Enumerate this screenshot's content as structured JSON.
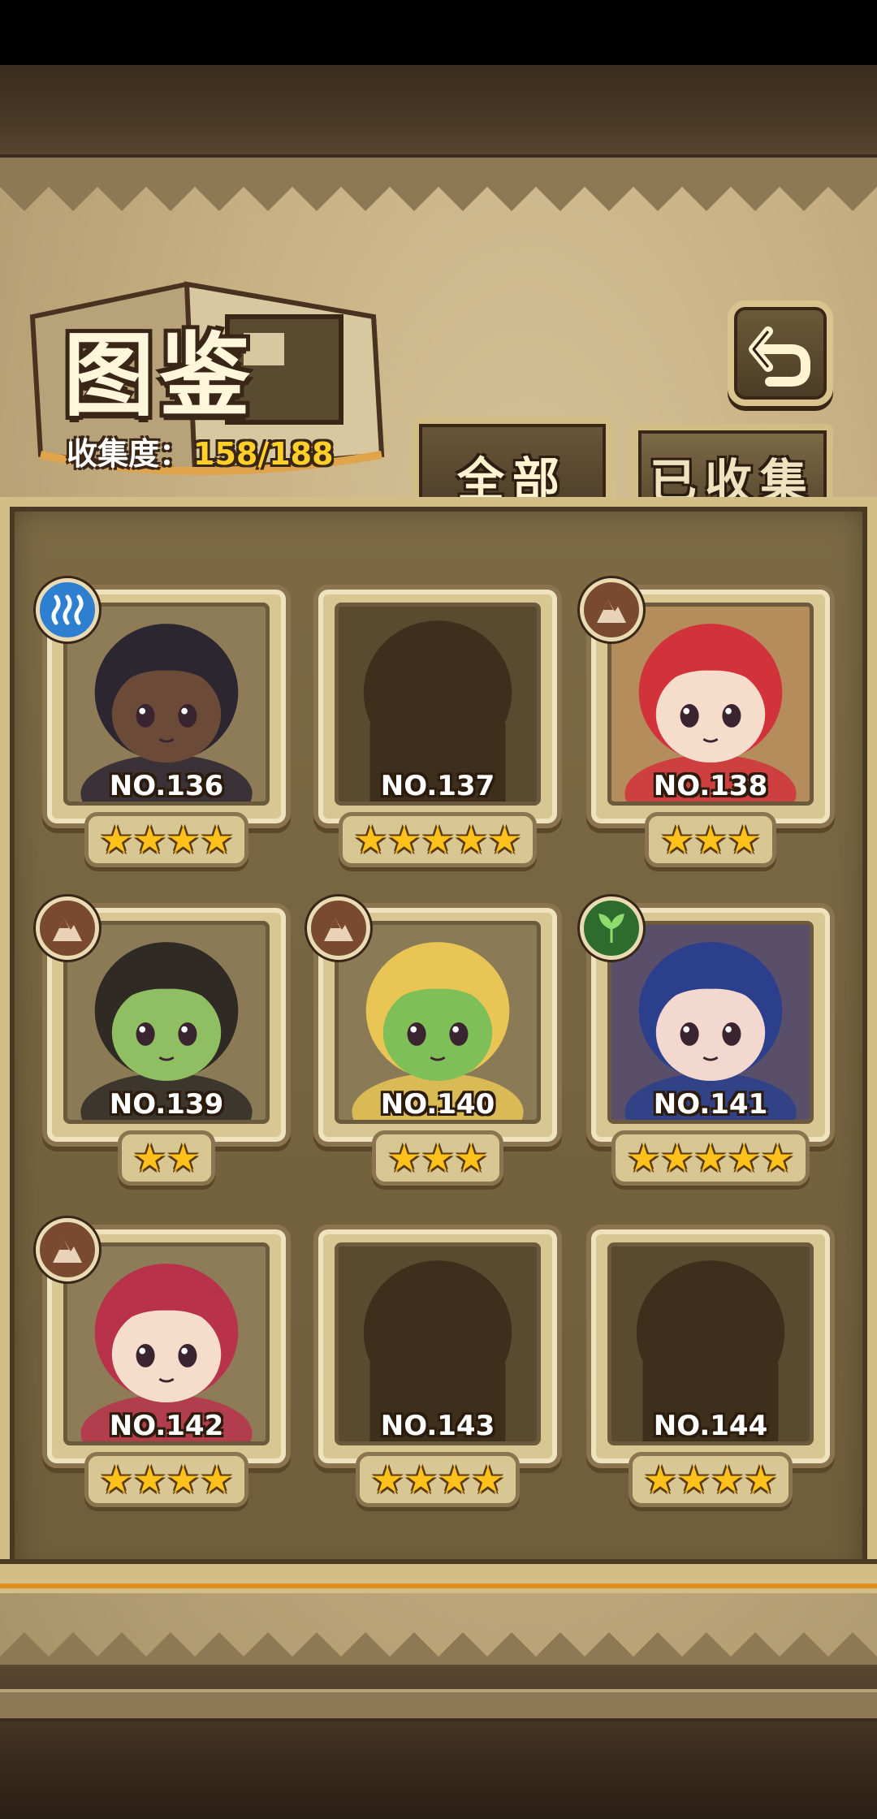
{
  "header": {
    "title": "图鉴",
    "collect_label": "收集度：",
    "collect_value": "158/188"
  },
  "tabs": [
    {
      "label": "全部",
      "active": true
    },
    {
      "label": "已收集",
      "active": false
    }
  ],
  "cards": [
    {
      "number": "NO.136",
      "stars": "★★★★",
      "element": "water-icon",
      "owned": true,
      "hair": "#2b2630",
      "skin": "#6b4a38",
      "bg": "#8e7c58"
    },
    {
      "number": "NO.137",
      "stars": "★★★★★",
      "element": "",
      "owned": false
    },
    {
      "number": "NO.138",
      "stars": "★★★",
      "element": "earth-icon",
      "owned": true,
      "hair": "#d2333a",
      "skin": "#f6dccb",
      "bg": "#b58c5c"
    },
    {
      "number": "NO.139",
      "stars": "★★",
      "element": "earth-icon",
      "owned": true,
      "hair": "#2f2a24",
      "skin": "#8fbf62",
      "bg": "#8a7a56"
    },
    {
      "number": "NO.140",
      "stars": "★★★",
      "element": "earth-icon",
      "owned": true,
      "hair": "#e8c554",
      "skin": "#7fbf57",
      "bg": "#8a7a56"
    },
    {
      "number": "NO.141",
      "stars": "★★★★★",
      "element": "grass-icon",
      "owned": true,
      "hair": "#2c3f8c",
      "skin": "#f3d8d0",
      "bg": "#594f6a"
    },
    {
      "number": "NO.142",
      "stars": "★★★★",
      "element": "earth-icon",
      "owned": true,
      "hair": "#b8324a",
      "skin": "#f6dccb",
      "bg": "#8e7c58"
    },
    {
      "number": "NO.143",
      "stars": "★★★★",
      "element": "",
      "owned": false
    },
    {
      "number": "NO.144",
      "stars": "★★★★",
      "element": "",
      "owned": false
    }
  ],
  "colors": {
    "star": "#ffc21d",
    "collect_value": "#ffcf2a",
    "water": "#2f7fd0",
    "earth": "#7a4a30",
    "grass": "#2e6b2e"
  }
}
